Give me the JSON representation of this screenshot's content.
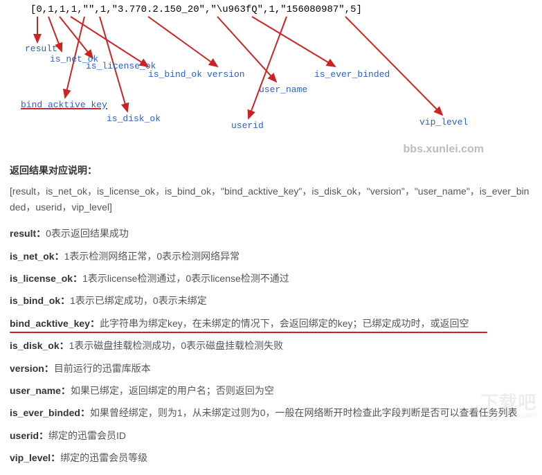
{
  "diagram": {
    "code": "[0,1,1,1,\"\",1,\"3.770.2.150_20\",\"\\u963fQ\",1,\"156080987\",5]",
    "labels": {
      "result": "result",
      "is_net_ok": "is_net_ok",
      "is_license_ok": "is_license_ok",
      "is_bind_ok": "is_bind_ok",
      "bind_acktive_key": "bind_acktive_key",
      "is_disk_ok": "is_disk_ok",
      "version": "version",
      "user_name": "user_name",
      "is_ever_binded": "is_ever_binded",
      "userid": "userid",
      "vip_level": "vip_level"
    }
  },
  "watermark": "bbs.xunlei.com",
  "doc": {
    "heading": "返回结果对应说明：",
    "array_line": "[result，is_net_ok，is_license_ok，is_bind_ok，\"bind_acktive_key\"，is_disk_ok，\"version\"，\"user_name\"，is_ever_binded，userid，vip_level]",
    "rows": {
      "result": {
        "k": "result：",
        "v": "0表示返回结果成功"
      },
      "is_net_ok": {
        "k": "is_net_ok：",
        "v": "1表示检测网络正常，0表示检测网络异常"
      },
      "is_license_ok": {
        "k": "is_license_ok：",
        "v": "1表示license检测通过，0表示license检测不通过"
      },
      "is_bind_ok": {
        "k": "is_bind_ok：",
        "v": "1表示已绑定成功，0表示未绑定"
      },
      "bind_acktive_key": {
        "k": "bind_acktive_key：",
        "v": "此字符串为绑定key，在未绑定的情况下，会返回绑定的key；已绑定成功时，或返回空"
      },
      "is_disk_ok": {
        "k": "is_disk_ok：",
        "v": "1表示磁盘挂载检测成功，0表示磁盘挂载检测失败"
      },
      "version": {
        "k": "version：",
        "v": "目前运行的迅雷库版本"
      },
      "user_name": {
        "k": "user_name：",
        "v": "如果已绑定，返回绑定的用户名；否则返回为空"
      },
      "is_ever_binded": {
        "k": "is_ever_binded：",
        "v": "如果曾经绑定，则为1，从未绑定过则为0，一般在网络断开时检查此字段判断是否可以查看任务列表"
      },
      "userid": {
        "k": "userid：",
        "v": "绑定的迅雷会员ID"
      },
      "vip_level": {
        "k": "vip_level：",
        "v": "绑定的迅雷会员等级"
      }
    }
  },
  "corner": {
    "line1": "下载吧",
    "line2": "www.xiazaiba.com"
  }
}
